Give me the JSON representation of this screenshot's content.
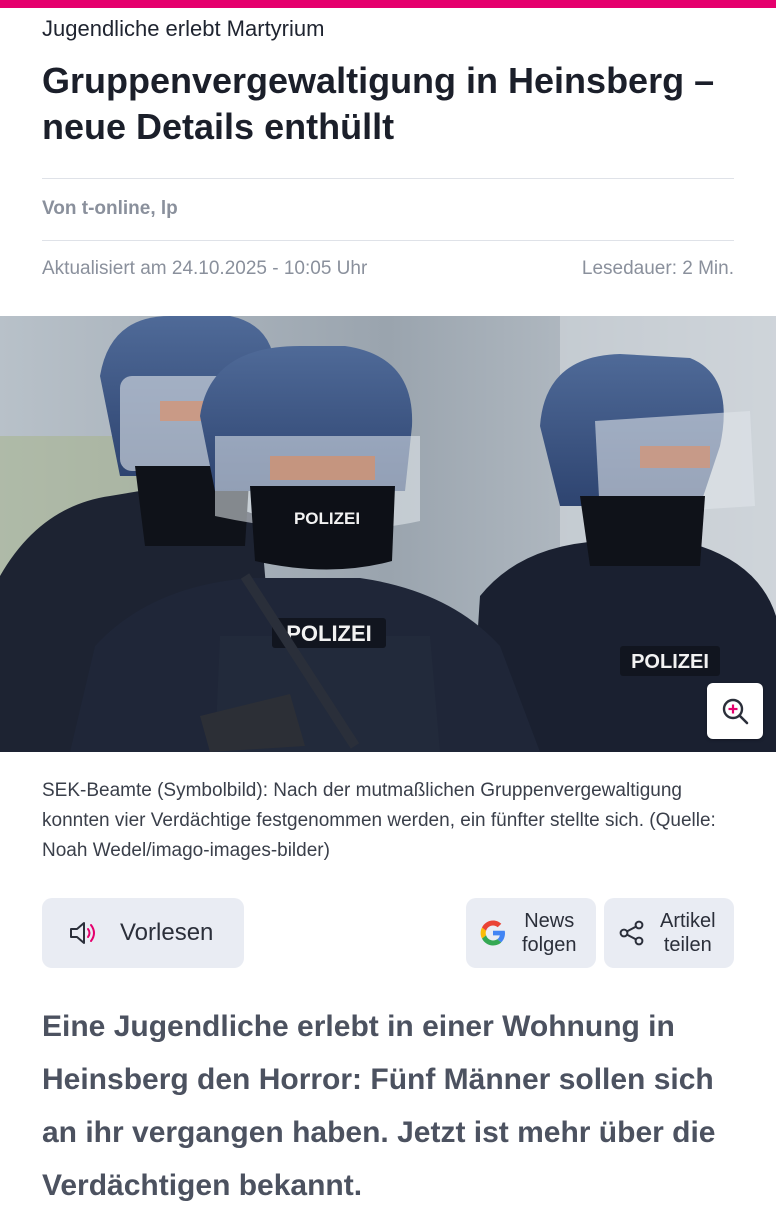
{
  "article": {
    "kicker": "Jugendliche erlebt Martyrium",
    "headline": "Gruppenvergewaltigung in Heinsberg – neue Details enthüllt",
    "author": "Von t-online, lp",
    "updated": "Aktualisiert am 24.10.2025 - 10:05 Uhr",
    "reading_time": "Lesedauer: 2 Min.",
    "image": {
      "vest_text": "POLIZEI",
      "mask_text": "POLIZEI",
      "zoom_icon": "zoom-in-icon"
    },
    "caption": "SEK-Beamte (Symbolbild): Nach der mutmaßlichen Gruppenvergewaltigung konnten vier Verdächtige festgenommen werden, ein fünfter stellte sich. (Quelle: Noah Wedel/imago-images-bilder)",
    "lead": "Eine Jugendliche erlebt in einer Wohnung in Heinsberg den Horror: Fünf Männer sollen sich an ihr vergangen haben. Jetzt ist mehr über die Verdächtigen bekannt."
  },
  "actions": {
    "read_aloud": {
      "label": "Vorlesen",
      "icon": "speaker-icon"
    },
    "news_follow": {
      "line1": "News",
      "line2": "folgen",
      "icon": "google-icon"
    },
    "share": {
      "line1": "Artikel",
      "line2": "teilen",
      "icon": "share-icon"
    }
  },
  "colors": {
    "brand": "#e5006d",
    "button_bg": "#e9ecf3",
    "meta_text": "#8a909c"
  }
}
